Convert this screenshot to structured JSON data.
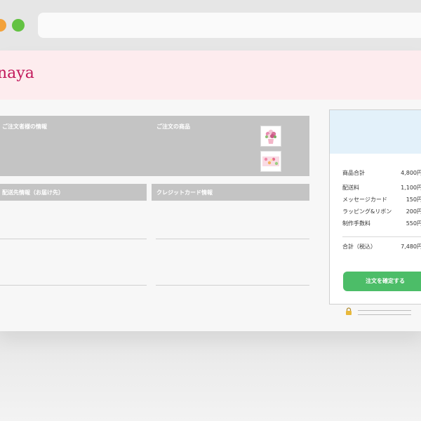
{
  "brand": {
    "logo_text": "naya"
  },
  "sections": {
    "orderer_info": "ご注文者様の情報",
    "order_items": "ご注文の商品",
    "shipping_info": "配送先情報（お届け先）",
    "credit_card_info": "クレジットカード情報"
  },
  "products": [
    {
      "icon": "flower-arrangement-thumbnail"
    },
    {
      "icon": "gift-box-thumbnail"
    }
  ],
  "summary": {
    "rows": [
      {
        "label": "商品合計",
        "value": "4,800円"
      },
      {
        "label": "配送料",
        "value": "1,100円"
      },
      {
        "label": "メッセージカード",
        "value": "150円"
      },
      {
        "label": "ラッピング&リボン",
        "value": "200円"
      },
      {
        "label": "制作手数料",
        "value": "550円"
      }
    ],
    "total_label": "合計（税込）",
    "total_value": "7,480円",
    "confirm_label": "注文を確定する"
  },
  "colors": {
    "brand_pink": "#c2185b",
    "banner_bg": "#fdecee",
    "confirm_green": "#4cbd68",
    "summary_head_bg": "#e3f1fa"
  }
}
